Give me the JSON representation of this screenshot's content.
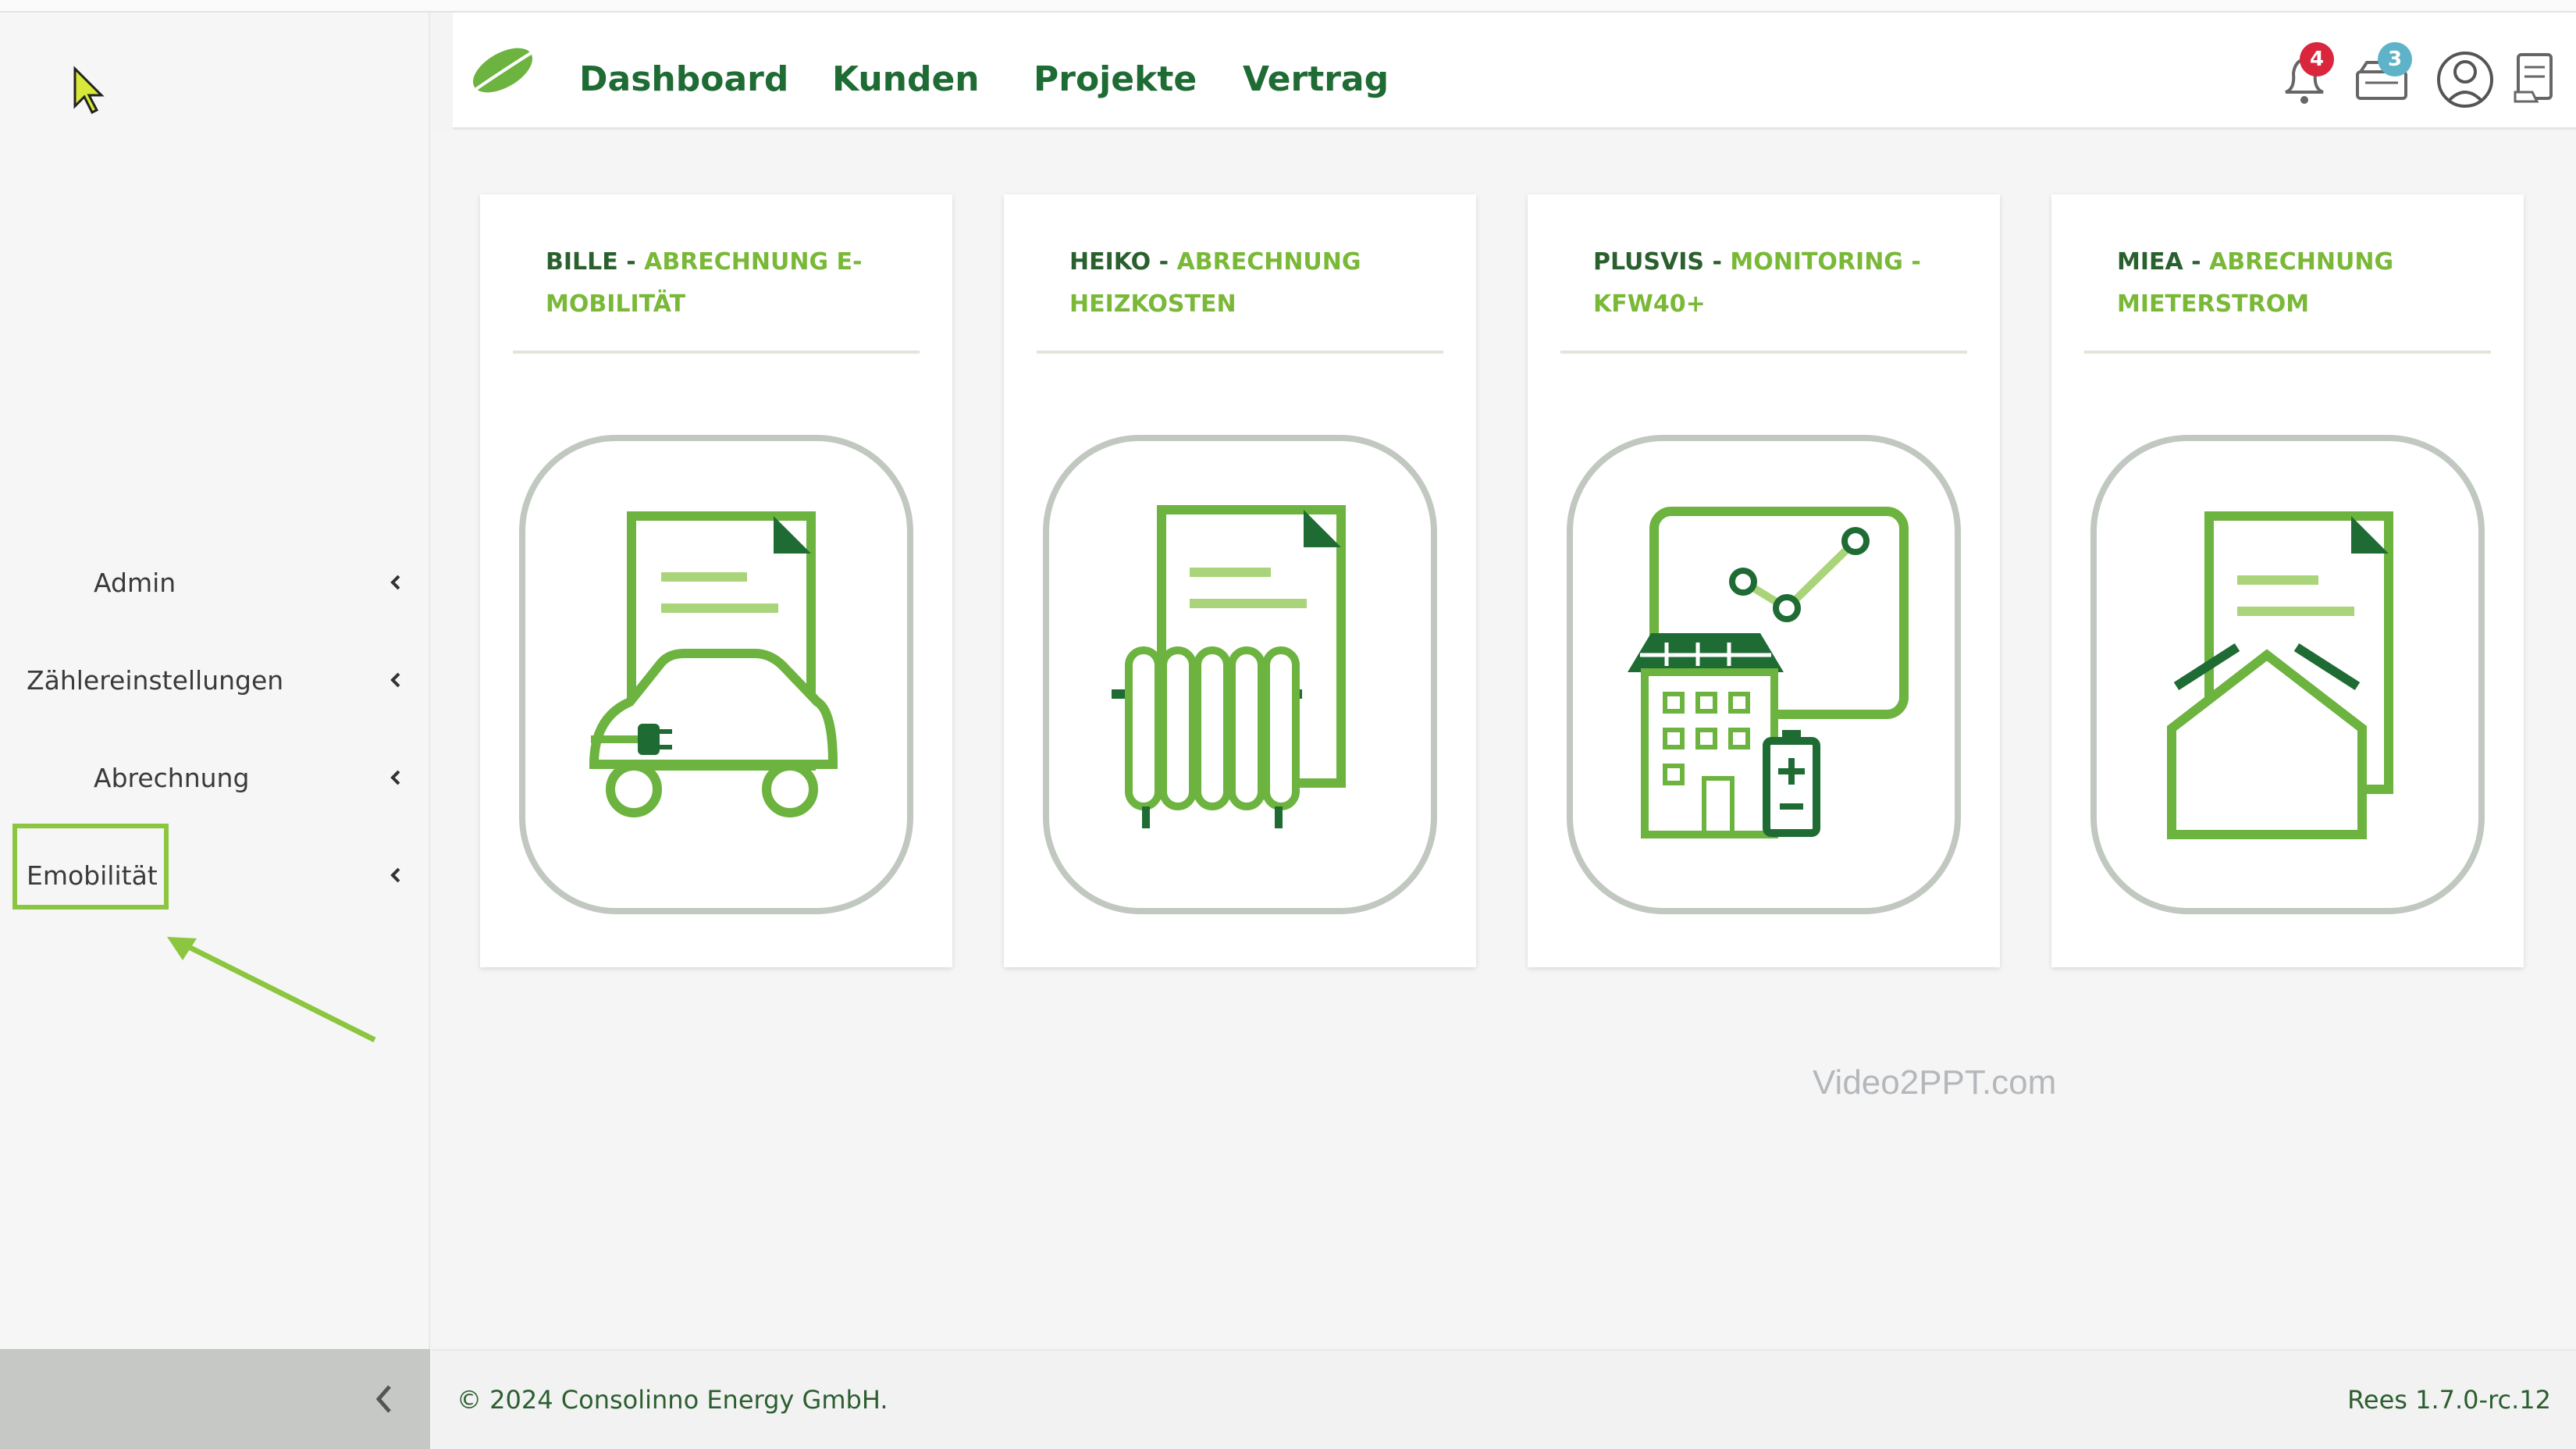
{
  "sidebar": {
    "items": [
      {
        "label": "Admin"
      },
      {
        "label": "Zählereinstellungen"
      },
      {
        "label": "Abrechnung"
      },
      {
        "label": "Emobilität"
      }
    ]
  },
  "header": {
    "nav": [
      "Dashboard",
      "Kunden",
      "Projekte",
      "Vertrag"
    ],
    "notifications_badge": "4",
    "messages_badge": "3"
  },
  "cards": [
    {
      "name": "BILLE",
      "rest": "ABRECHNUNG E-MOBILITÄT",
      "icon": "ev-charging-document-icon"
    },
    {
      "name": "HEIKO",
      "rest": "ABRECHNUNG HEIZKOSTEN",
      "icon": "radiator-document-icon"
    },
    {
      "name": "PLUSVIS",
      "rest": "MONITORING - KFW40+",
      "icon": "solar-house-monitoring-icon"
    },
    {
      "name": "MIEA",
      "rest": "ABRECHNUNG MIETERSTROM",
      "icon": "house-document-icon"
    }
  ],
  "watermark": "Video2PPT.com",
  "footer": {
    "copyright": "© 2024 Consolinno Energy GmbH.",
    "version": "Rees 1.7.0-rc.12"
  },
  "colors": {
    "primary_green": "#1f6b34",
    "accent_green": "#7ab838",
    "badge_red": "#d9263d",
    "badge_blue": "#5fb3c9"
  }
}
